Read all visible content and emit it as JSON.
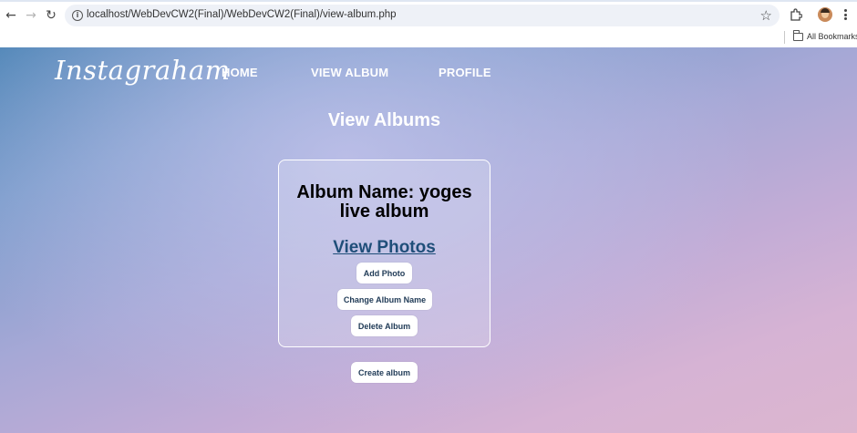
{
  "browser": {
    "url": "localhost/WebDevCW2(Final)/WebDevCW2(Final)/view-album.php",
    "bookmarks_label": "All Bookmarks",
    "icons": {
      "back": "back-arrow-icon",
      "forward": "forward-arrow-icon",
      "reload": "reload-icon",
      "site_info": "info-icon",
      "bookmark": "star-icon",
      "extensions": "puzzle-icon",
      "profile": "profile-avatar",
      "menu": "kebab-menu-icon",
      "bookmarks_folder": "folder-icon"
    }
  },
  "site": {
    "logo": "Instagraham",
    "nav": [
      "HOME",
      "VIEW ALBUM",
      "PROFILE"
    ]
  },
  "main": {
    "title": "View Albums",
    "album": {
      "name": "Album Name: yoges live album",
      "view_photos": "View Photos",
      "buttons": {
        "add": "Add Photo",
        "rename": "Change Album Name",
        "delete": "Delete Album"
      }
    },
    "create_button": "Create album"
  },
  "colors": {
    "link": "#1f4e79",
    "button_text": "#1f3a56",
    "gradient_top_left": "#4f86b7",
    "gradient_bottom_right": "#dcb6cf"
  }
}
